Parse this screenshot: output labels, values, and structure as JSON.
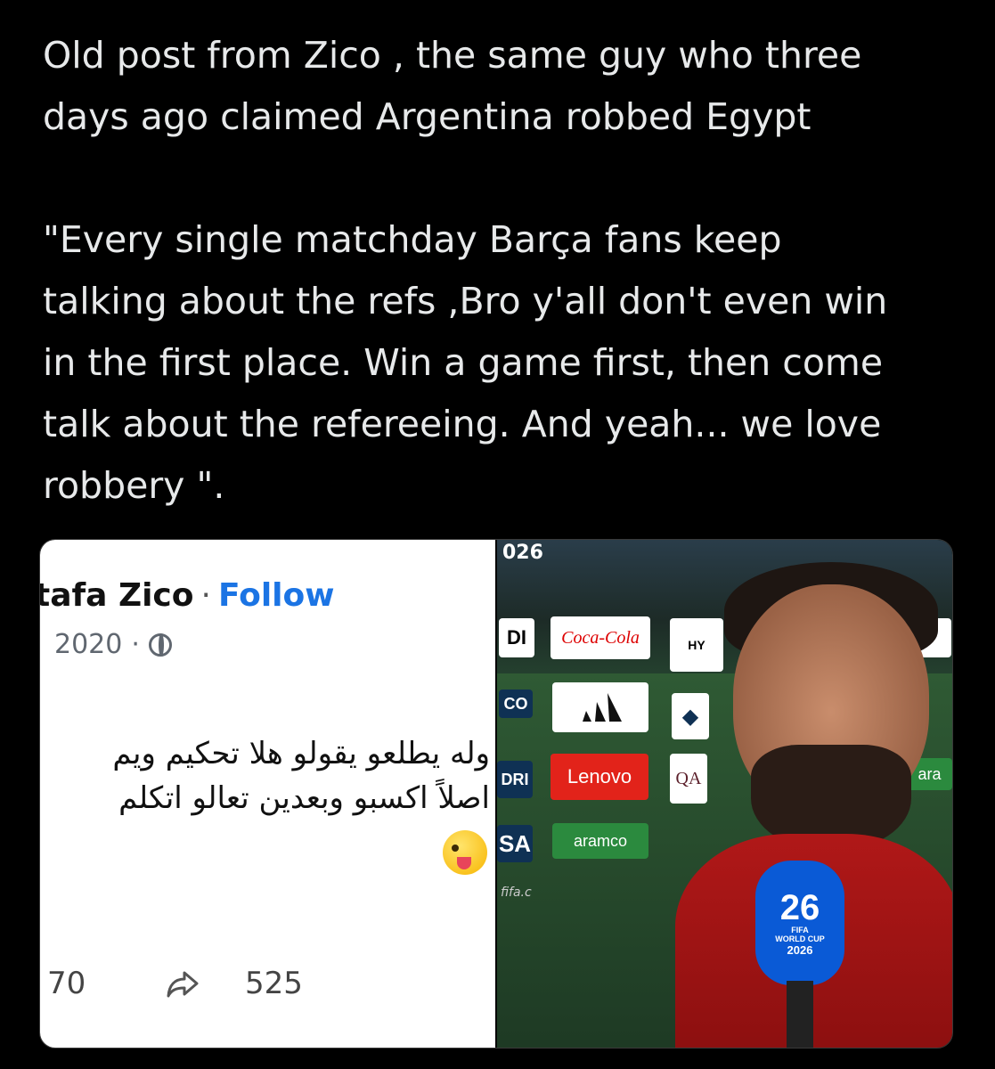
{
  "post": {
    "line1": "Old post from Zico , the same guy who three",
    "line2": "days ago claimed Argentina robbed Egypt",
    "quote": [
      "\"Every single matchday Barça fans keep",
      "talking about the refs ,Bro y'all don't even win",
      "in the first place. Win a game first, then come",
      "talk about the refereeing. And yeah... we love",
      "robbery \"."
    ]
  },
  "screenshot": {
    "name": "tafa Zico",
    "separator": "·",
    "follow": "Follow",
    "year": "2020",
    "meta_sep": "·",
    "globe_icon": "globe-icon",
    "arabic_lines": [
      "وله يطلعو يقولو هلا تحكيم ويم",
      "اصلاً اكسبو وبعدين تعالو اتكلم"
    ],
    "emoji_icon": "winking-tongue-emoji",
    "reactions_count": "70",
    "share_icon": "share-icon",
    "shares_count": "525"
  },
  "photo": {
    "year_fragment": "026",
    "boards": {
      "cocacola": "Coca-Cola",
      "lenovo": "Lenovo",
      "aramco": "aramco",
      "di": "DI",
      "co": "CO",
      "qa": "QA",
      "sa": "SA",
      "hy": "HY",
      "dri": "DRI",
      "ara": "ara",
      "a": "A",
      "fifa_url": "fifa.c"
    },
    "mic": {
      "logo": "26",
      "brand": "FIFA",
      "event": "WORLD CUP",
      "year": "2026"
    }
  }
}
